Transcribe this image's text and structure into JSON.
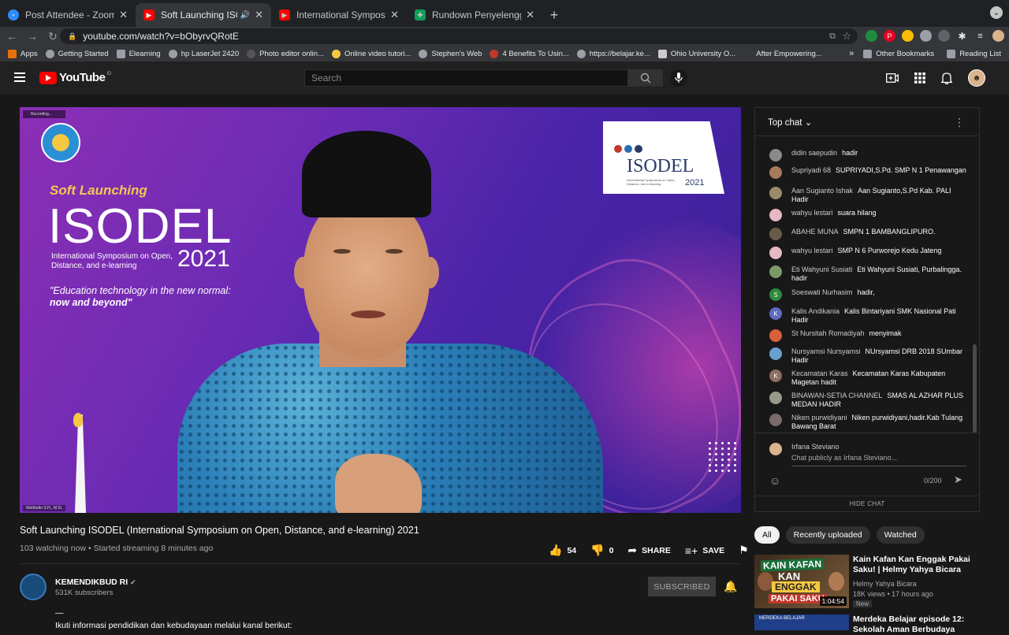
{
  "browser": {
    "tabs": [
      {
        "title": "Post Attendee - Zoom",
        "icon": "zoom-icon",
        "color": "#2d8cff"
      },
      {
        "title": "Soft Launching ISODEL (Int",
        "icon": "youtube-icon",
        "color": "#ff0000",
        "active": true
      },
      {
        "title": "International Symposium on Op",
        "icon": "youtube-icon",
        "color": "#ff0000"
      },
      {
        "title": "Rundown Penyelenggaraan ISO",
        "icon": "sheets-icon",
        "color": "#0f9d58"
      }
    ],
    "url": "youtube.com/watch?v=bObyrvQRotE",
    "bookmarks": [
      "Apps",
      "Getting Started",
      "Elearning",
      "hp LaserJet 2420",
      "Photo editor onlin...",
      "Online video tutori...",
      "Stephen's Web",
      "4 Benefits To Usin...",
      "https://belajar.ke...",
      "Ohio University O...",
      "After Empowering..."
    ],
    "bookmarks_more": "»",
    "other_bookmarks": "Other Bookmarks",
    "reading_list": "Reading List"
  },
  "youtube": {
    "logo_text": "YouTube",
    "logo_country": "ID",
    "search_placeholder": "Search"
  },
  "video": {
    "slide": {
      "recording": "Recording...",
      "soft": "Soft Launching",
      "isodel": "ISODEL",
      "symposium": "International Symposium on Open, Distance, and e-learning",
      "year": "2021",
      "tagline1": "\"Education technology in the new normal:",
      "tagline2": "now and beyond\"",
      "logo_text": "ISODEL",
      "logo_sub": "International Symposium on Open, Distance, and e-learning",
      "logo_year": "2021",
      "nameplate": "Wahfudin S.H., M.Si."
    },
    "title": "Soft Launching ISODEL (International Symposium on Open, Distance, and e-learning) 2021",
    "meta": "103 watching now • Started streaming 8 minutes ago",
    "likes": "54",
    "dislikes": "0",
    "share": "SHARE",
    "save": "SAVE"
  },
  "channel": {
    "name": "KEMENDIKBUD RI",
    "subs": "531K subscribers",
    "subscribed": "SUBSCRIBED",
    "desc1": "—",
    "desc2": "Ikuti informasi pendidikan dan kebudayaan melalui kanal berikut:"
  },
  "chat": {
    "header": "Top chat",
    "messages": [
      {
        "author": "didin saepudin",
        "text": "hadir",
        "color": "#8a8a8a",
        "initial": ""
      },
      {
        "author": "Supriyadi 68",
        "text": "SUPRIYADI,S.Pd. SMP N 1 Penawangan",
        "color": "#a87a5a",
        "initial": ""
      },
      {
        "author": "Aan Sugianto Ishak",
        "text": "Aan Sugianto,S.Pd Kab. PALI Hadir",
        "color": "#9a8a6a",
        "initial": ""
      },
      {
        "author": "wahyu lestari",
        "text": "suara hilang",
        "color": "#e6b8c4",
        "initial": ""
      },
      {
        "author": "ABAHE MUNA",
        "text": "SMPN 1 BAMBANGLIPURO.",
        "color": "#6a5a4a",
        "initial": ""
      },
      {
        "author": "wahyu lestari",
        "text": "SMP N 6 Purworejo Kedu Jateng",
        "color": "#e6b8c4",
        "initial": ""
      },
      {
        "author": "Eti Wahyuni Susiati",
        "text": "Eti Wahyuni Susiati, Purbalingga. hadir",
        "color": "#7a9a6a",
        "initial": ""
      },
      {
        "author": "Soeswati Nurhasim",
        "text": "hadir,",
        "color": "#2e8b3a",
        "initial": "S"
      },
      {
        "author": "Kalis Andikania",
        "text": "Kalis Bintariyani SMK Nasional Pati Hadir",
        "color": "#5c6bc0",
        "initial": "K"
      },
      {
        "author": "St Nursitah Romadiyah",
        "text": "menyimak",
        "color": "#d9603a",
        "initial": ""
      },
      {
        "author": "Nursyamsi Nursyamsi",
        "text": "NUrsyamsi DRB 2018 SUmbar Hadir",
        "color": "#6aa0d0",
        "initial": ""
      },
      {
        "author": "Kecamatan Karas",
        "text": "Kecamatan Karas Kabupaten Magetan hadit",
        "color": "#8d6e63",
        "initial": "K"
      },
      {
        "author": "BINAWAN-SETIA CHANNEL",
        "text": "SMAS AL AZHAR PLUS MEDAN HADIR",
        "color": "#9a9a8a",
        "initial": ""
      },
      {
        "author": "Niken purwidiyani",
        "text": "Niken purwidiyani,hadir.Kab Tulang Bawang Barat",
        "color": "#7a6a6a",
        "initial": ""
      }
    ],
    "user": "Irfana Steviano",
    "placeholder": "Chat publicly as Irfana Steviano...",
    "count": "0/200",
    "hide": "HIDE CHAT"
  },
  "chips": [
    "All",
    "Recently uploaded",
    "Watched"
  ],
  "recommendations": [
    {
      "title": "Kain Kafan Kan Enggak Pakai Saku! | Helmy Yahya Bicara",
      "channel": "Helmy Yahya Bicara",
      "views": "18K views • 17 hours ago",
      "badge": "New",
      "duration": "1:04:54",
      "thumb_l1": "KAIN KAFAN",
      "thumb_l2": "KAN",
      "thumb_l3": "ENGGAK",
      "thumb_l4": "PAKAI SAKU"
    },
    {
      "title": "Merdeka Belajar episode 12: Sekolah Aman Berbudaya",
      "thumb_text": "MERDEKA BELAJAR"
    }
  ]
}
